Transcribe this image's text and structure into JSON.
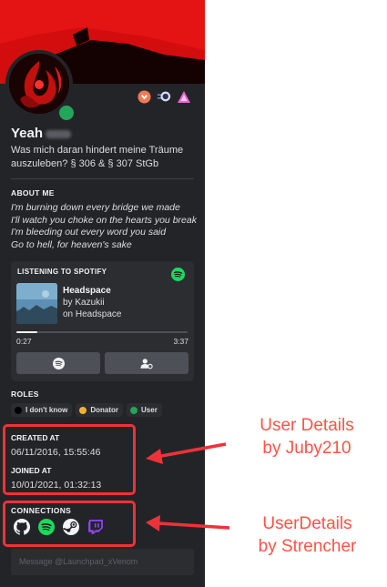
{
  "profile": {
    "username": "Yeah",
    "custom_status": "Was mich daran hindert meine Träume auszuleben? § 306 & § 307 StGb"
  },
  "about": {
    "title": "ABOUT ME",
    "lines": [
      "I'm burning down every bridge we made",
      "I'll watch you choke on the hearts you break",
      "I'm bleeding out every word you said",
      "Go to hell, for heaven's sake"
    ]
  },
  "spotify": {
    "title": "LISTENING TO SPOTIFY",
    "track": "Headspace",
    "artist": "by Kazukii",
    "album": "on Headspace",
    "elapsed": "0:27",
    "duration": "3:37",
    "progress_percent": 12
  },
  "roles": {
    "title": "ROLES",
    "items": [
      {
        "name": "I don't know",
        "color": "#000000"
      },
      {
        "name": "Donator",
        "color": "#f0b232"
      },
      {
        "name": "User",
        "color": "#23a55a"
      }
    ]
  },
  "user_details": {
    "created_label": "CREATED AT",
    "created_value": "06/11/2016, 15:55:46",
    "joined_label": "JOINED AT",
    "joined_value": "10/01/2021, 01:32:13"
  },
  "connections": {
    "title": "CONNECTIONS",
    "items": [
      "github-icon",
      "spotify-icon",
      "steam-icon",
      "twitch-icon"
    ]
  },
  "message_box": {
    "placeholder": "Message @Launchpad_xVenom"
  },
  "annotations": {
    "user_details_line1": "User Details",
    "user_details_line2": "by Juby210",
    "connections_line1": "UserDetails",
    "connections_line2": "by Strencher"
  },
  "colors": {
    "highlight": "#ec3339",
    "annotation_text": "#ff5346",
    "status_online": "#23a55a",
    "spotify_green": "#1ed760",
    "banner_red": "#d30d0d"
  }
}
